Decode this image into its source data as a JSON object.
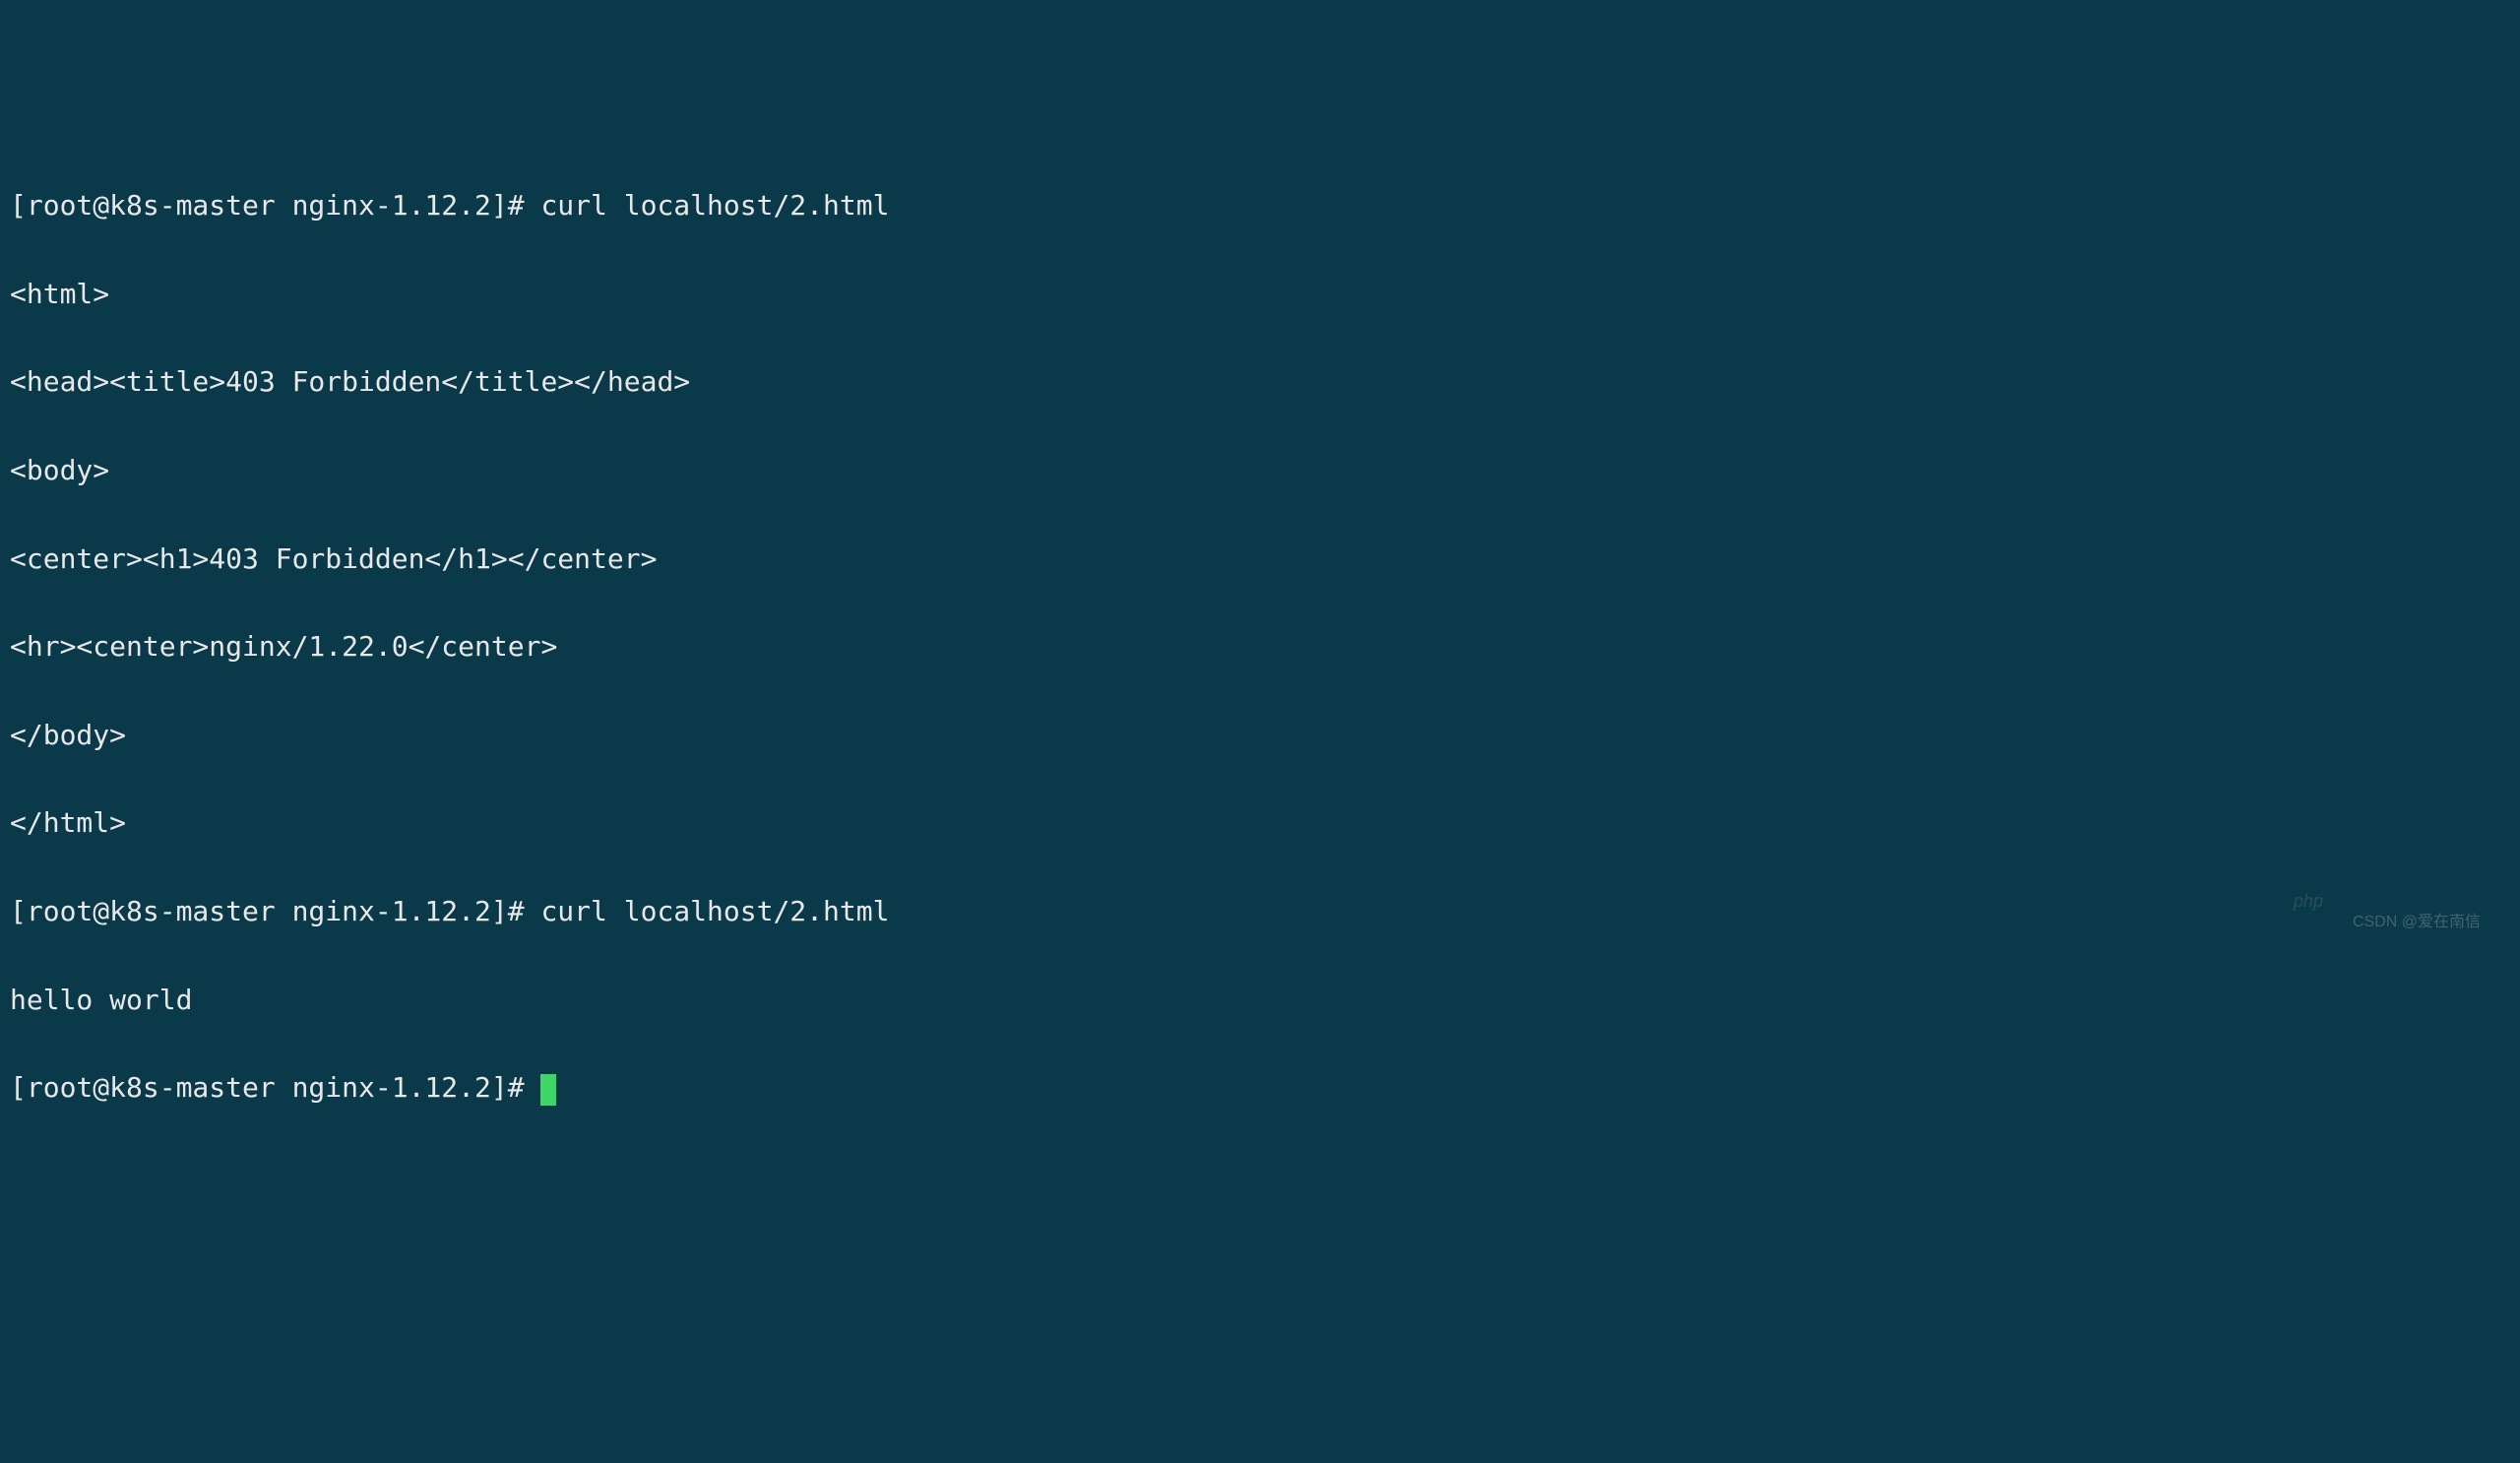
{
  "terminal": {
    "lines": [
      "[root@k8s-master nginx-1.12.2]# curl localhost/2.html",
      "<html>",
      "<head><title>403 Forbidden</title></head>",
      "<body>",
      "<center><h1>403 Forbidden</h1></center>",
      "<hr><center>nginx/1.22.0</center>",
      "</body>",
      "</html>",
      "[root@k8s-master nginx-1.12.2]# curl localhost/2.html",
      "hello world",
      "[root@k8s-master nginx-1.12.2]# "
    ],
    "prompt": "[root@k8s-master nginx-1.12.2]# ",
    "command": "curl localhost/2.html",
    "cursor_visible": true
  },
  "watermark": {
    "text1": "CSDN @爱在南信",
    "text2": "php"
  },
  "colors": {
    "background": "#0a3a4a",
    "text": "#e8e8e8",
    "cursor": "#3fd668"
  }
}
